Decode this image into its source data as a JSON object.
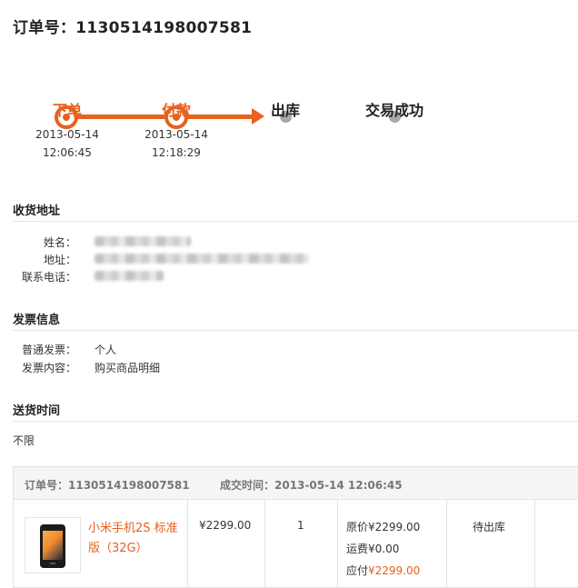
{
  "order_title": "订单号：1130514198007581",
  "steps": [
    {
      "label": "下单",
      "date": "2013-05-14",
      "time": "12:06:45",
      "state": "done"
    },
    {
      "label": "付款",
      "date": "2013-05-14",
      "time": "12:18:29",
      "state": "done"
    },
    {
      "label": "出库",
      "state": "todo"
    },
    {
      "label": "交易成功",
      "state": "todo"
    }
  ],
  "address": {
    "title": "收货地址",
    "name_label": "姓名：",
    "addr_label": "地址：",
    "phone_label": "联系电话："
  },
  "invoice": {
    "title": "发票信息",
    "type_label": "普通发票：",
    "type_value": "个人",
    "content_label": "发票内容：",
    "content_value": "购买商品明细"
  },
  "delivery": {
    "title": "送货时间",
    "value": "不限"
  },
  "order": {
    "number_text": "订单号：1130514198007581",
    "deal_time_text": "成交时间：2013-05-14 12:06:45",
    "product_name": "小米手机2S 标准版（32G）",
    "unit_price": "¥2299.00",
    "quantity": "1",
    "original_price": "原价¥2299.00",
    "shipping": "运费¥0.00",
    "payable_label": "应付",
    "payable_value": "¥2299.00",
    "status": "待出库"
  },
  "colors": {
    "accent": "#e8611f",
    "idle": "#a8a8a8"
  }
}
